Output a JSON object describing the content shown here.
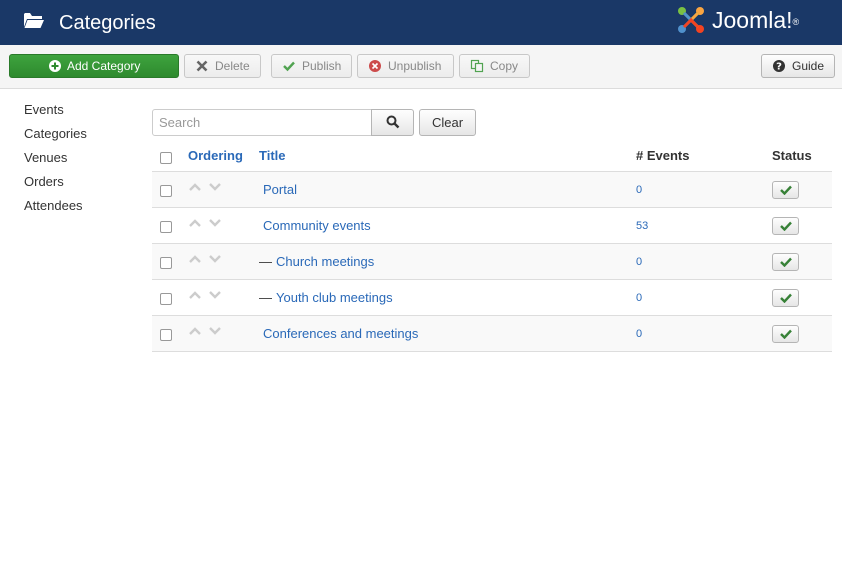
{
  "header": {
    "title": "Categories",
    "logo_text": "Joomla!",
    "logo_mark": "®"
  },
  "toolbar": {
    "add_label": "Add Category",
    "delete_label": "Delete",
    "publish_label": "Publish",
    "unpublish_label": "Unpublish",
    "copy_label": "Copy",
    "guide_label": "Guide"
  },
  "sidebar": {
    "items": [
      {
        "label": "Events"
      },
      {
        "label": "Categories"
      },
      {
        "label": "Venues"
      },
      {
        "label": "Orders"
      },
      {
        "label": "Attendees"
      }
    ]
  },
  "search": {
    "placeholder": "Search",
    "value": "",
    "clear_label": "Clear"
  },
  "table": {
    "columns": {
      "ordering": "Ordering",
      "title": "Title",
      "events": "# Events",
      "status": "Status"
    },
    "rows": [
      {
        "title": "Portal",
        "prefix": "",
        "events": "0"
      },
      {
        "title": "Community events",
        "prefix": "",
        "events": "53"
      },
      {
        "title": "Church meetings",
        "prefix": "—",
        "events": "0"
      },
      {
        "title": "Youth club meetings",
        "prefix": "—",
        "events": "0"
      },
      {
        "title": "Conferences and meetings",
        "prefix": "",
        "events": "0"
      }
    ]
  },
  "colors": {
    "header_bg": "#1a3867",
    "link": "#2a69b8",
    "success": "#3ea33e"
  }
}
